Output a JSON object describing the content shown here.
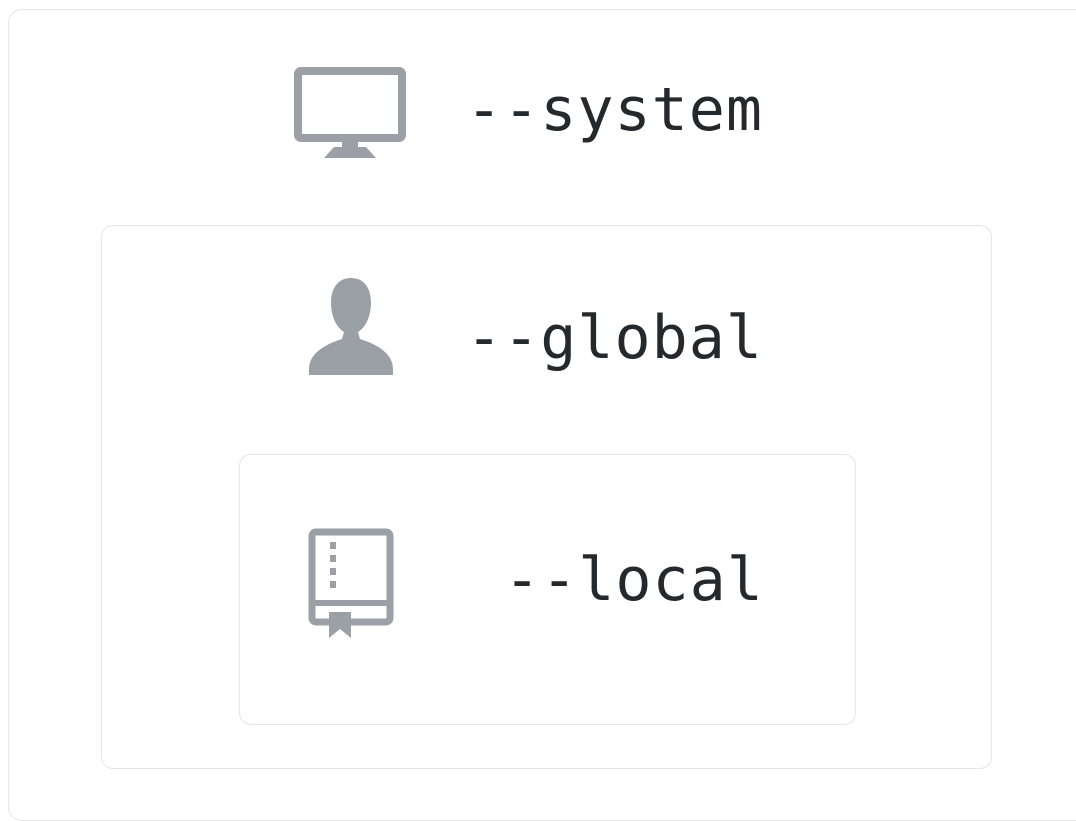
{
  "colors": {
    "icon": "#9aa0a6",
    "text": "#24292e",
    "border": "#e3e5e8"
  },
  "levels": [
    {
      "id": "system",
      "label": "--system",
      "icon": "monitor-icon"
    },
    {
      "id": "global",
      "label": "--global",
      "icon": "user-icon"
    },
    {
      "id": "local",
      "label": "--local",
      "icon": "repository-book-icon"
    }
  ]
}
